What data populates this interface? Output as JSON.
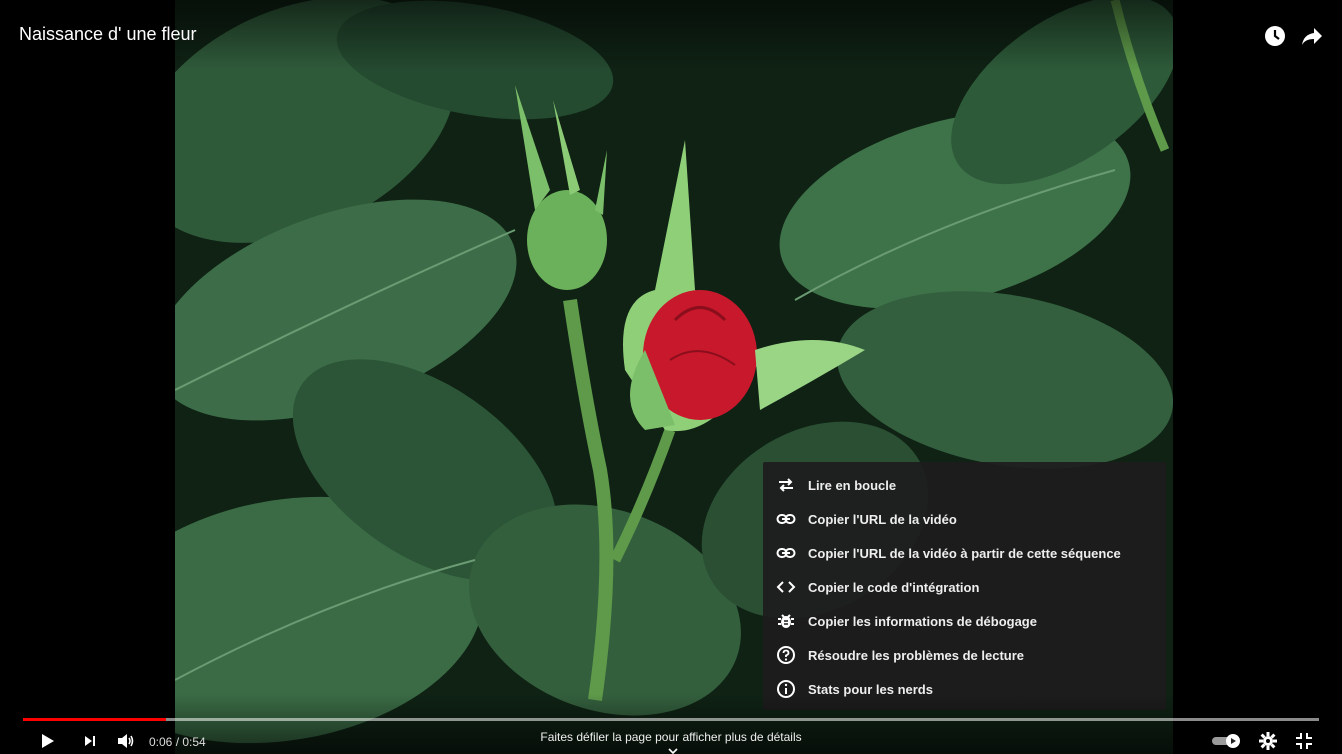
{
  "player": {
    "title": "Naissance d' une fleur",
    "current_time": "0:06",
    "separator": " / ",
    "duration": "0:54",
    "progress": 0.11,
    "scroll_hint": "Faites défiler la page pour afficher plus de détails"
  },
  "top_icons": [
    "clock-icon",
    "share-arrow-icon"
  ],
  "context_menu": {
    "items": [
      {
        "label": "Lire en boucle",
        "icon": "loop-icon"
      },
      {
        "label": "Copier l'URL de la vidéo",
        "icon": "link-icon"
      },
      {
        "label": "Copier l'URL de la vidéo à partir de cette séquence",
        "icon": "link-icon"
      },
      {
        "label": "Copier le code d'intégration",
        "icon": "embed-code-icon"
      },
      {
        "label": "Copier les informations de débogage",
        "icon": "bug-icon"
      },
      {
        "label": "Résoudre les problèmes de lecture",
        "icon": "help-circle-icon"
      },
      {
        "label": "Stats pour les nerds",
        "icon": "info-icon"
      }
    ]
  },
  "controls": [
    "play-icon",
    "next-icon",
    "volume-icon",
    "autoplay-toggle-icon",
    "settings-gear-icon",
    "exit-fullscreen-icon"
  ],
  "colors": {
    "accent": "#ff0000",
    "menu_bg": "#1c1c1c",
    "text": "#ffffff"
  }
}
